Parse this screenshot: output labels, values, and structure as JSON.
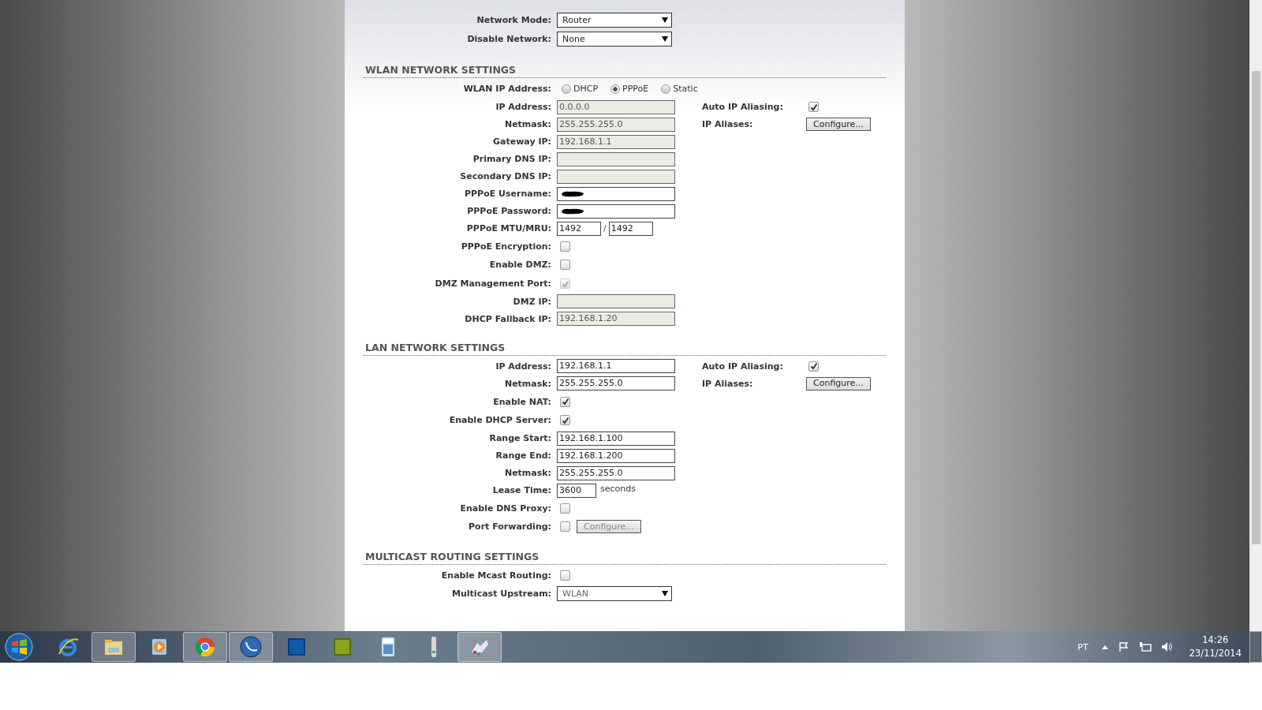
{
  "top_fields": [
    {
      "label": "Network Mode:",
      "kind": "select",
      "value": "Router",
      "disabled": false
    },
    {
      "label": "Disable Network:",
      "kind": "select",
      "value": "None",
      "disabled": false
    }
  ],
  "sections": [
    {
      "title": "WLAN NETWORK SETTINGS",
      "rows": [
        {
          "label": "WLAN IP Address:",
          "kind": "radio",
          "options": [
            {
              "label": "DHCP",
              "selected": false
            },
            {
              "label": "PPPoE",
              "selected": true
            },
            {
              "label": "Static",
              "selected": false
            }
          ]
        },
        {
          "label": "IP Address:",
          "kind": "text",
          "value": "0.0.0.0",
          "disabled": true,
          "right": {
            "label": "Auto IP Aliasing:",
            "kind": "checkbox",
            "checked": true
          }
        },
        {
          "label": "Netmask:",
          "kind": "text",
          "value": "255.255.255.0",
          "disabled": true,
          "right": {
            "label": "IP Aliases:",
            "kind": "button",
            "button": "Configure..."
          }
        },
        {
          "label": "Gateway IP:",
          "kind": "text",
          "value": "192.168.1.1",
          "disabled": true
        },
        {
          "label": "Primary DNS IP:",
          "kind": "text",
          "disabled": true
        },
        {
          "label": "Secondary DNS IP:",
          "kind": "text",
          "disabled": true
        },
        {
          "label": "PPPoE Username:",
          "kind": "text",
          "disabled": false,
          "redacted": true
        },
        {
          "label": "PPPoE Password:",
          "kind": "text",
          "disabled": false,
          "redacted": true
        },
        {
          "label": "PPPoE MTU/MRU:",
          "kind": "pair",
          "values": [
            "1492",
            "1492"
          ],
          "separator": "/"
        },
        {
          "label": "PPPoE Encryption:",
          "kind": "checkbox",
          "checked": false,
          "disabled": false
        },
        {
          "label": "Enable DMZ:",
          "kind": "checkbox",
          "checked": false,
          "disabled": false
        },
        {
          "label": "DMZ Management Port:",
          "kind": "checkbox",
          "checked": true,
          "disabled": true
        },
        {
          "label": "DMZ IP:",
          "kind": "text",
          "disabled": true
        },
        {
          "label": "DHCP Fallback IP:",
          "kind": "text",
          "value": "192.168.1.20",
          "disabled": true
        }
      ]
    },
    {
      "title": "LAN NETWORK SETTINGS",
      "rows": [
        {
          "label": "IP Address:",
          "kind": "text",
          "value": "192.168.1.1",
          "disabled": false,
          "right": {
            "label": "Auto IP Aliasing:",
            "kind": "checkbox",
            "checked": true
          }
        },
        {
          "label": "Netmask:",
          "kind": "text",
          "value": "255.255.255.0",
          "disabled": false,
          "right": {
            "label": "IP Aliases:",
            "kind": "button",
            "button": "Configure..."
          }
        },
        {
          "label": "Enable NAT:",
          "kind": "checkbox",
          "checked": true,
          "disabled": false
        },
        {
          "label": "Enable DHCP Server:",
          "kind": "checkbox",
          "checked": true,
          "disabled": false
        },
        {
          "label": "Range Start:",
          "kind": "text",
          "value": "192.168.1.100",
          "disabled": false
        },
        {
          "label": "Range End:",
          "kind": "text",
          "value": "192.168.1.200",
          "disabled": false
        },
        {
          "label": "Netmask:",
          "kind": "text",
          "value": "255.255.255.0",
          "disabled": false
        },
        {
          "label": "Lease Time:",
          "kind": "short",
          "value": "3600",
          "suffix": "seconds"
        },
        {
          "label": "Enable DNS Proxy:",
          "kind": "checkbox",
          "checked": false,
          "disabled": false
        },
        {
          "label": "Port Forwarding:",
          "kind": "checkbox",
          "checked": false,
          "disabled": false,
          "button": {
            "label": "Configure...",
            "disabled": true
          }
        }
      ]
    },
    {
      "title": "MULTICAST ROUTING SETTINGS",
      "rows": [
        {
          "label": "Enable Mcast Routing:",
          "kind": "checkbox",
          "checked": false,
          "disabled": false
        },
        {
          "label": "Multicast Upstream:",
          "kind": "select",
          "value": "WLAN",
          "disabled": true
        }
      ]
    }
  ],
  "taskbar": {
    "apps": [
      {
        "running": false
      },
      {
        "running": true
      },
      {
        "running": false
      },
      {
        "running": true
      },
      {
        "running": true
      },
      {
        "running": false
      },
      {
        "running": false
      },
      {
        "running": false
      },
      {
        "running": false
      },
      {
        "running": true
      }
    ],
    "language": "PT",
    "time": "14:26",
    "date": "23/11/2014"
  }
}
